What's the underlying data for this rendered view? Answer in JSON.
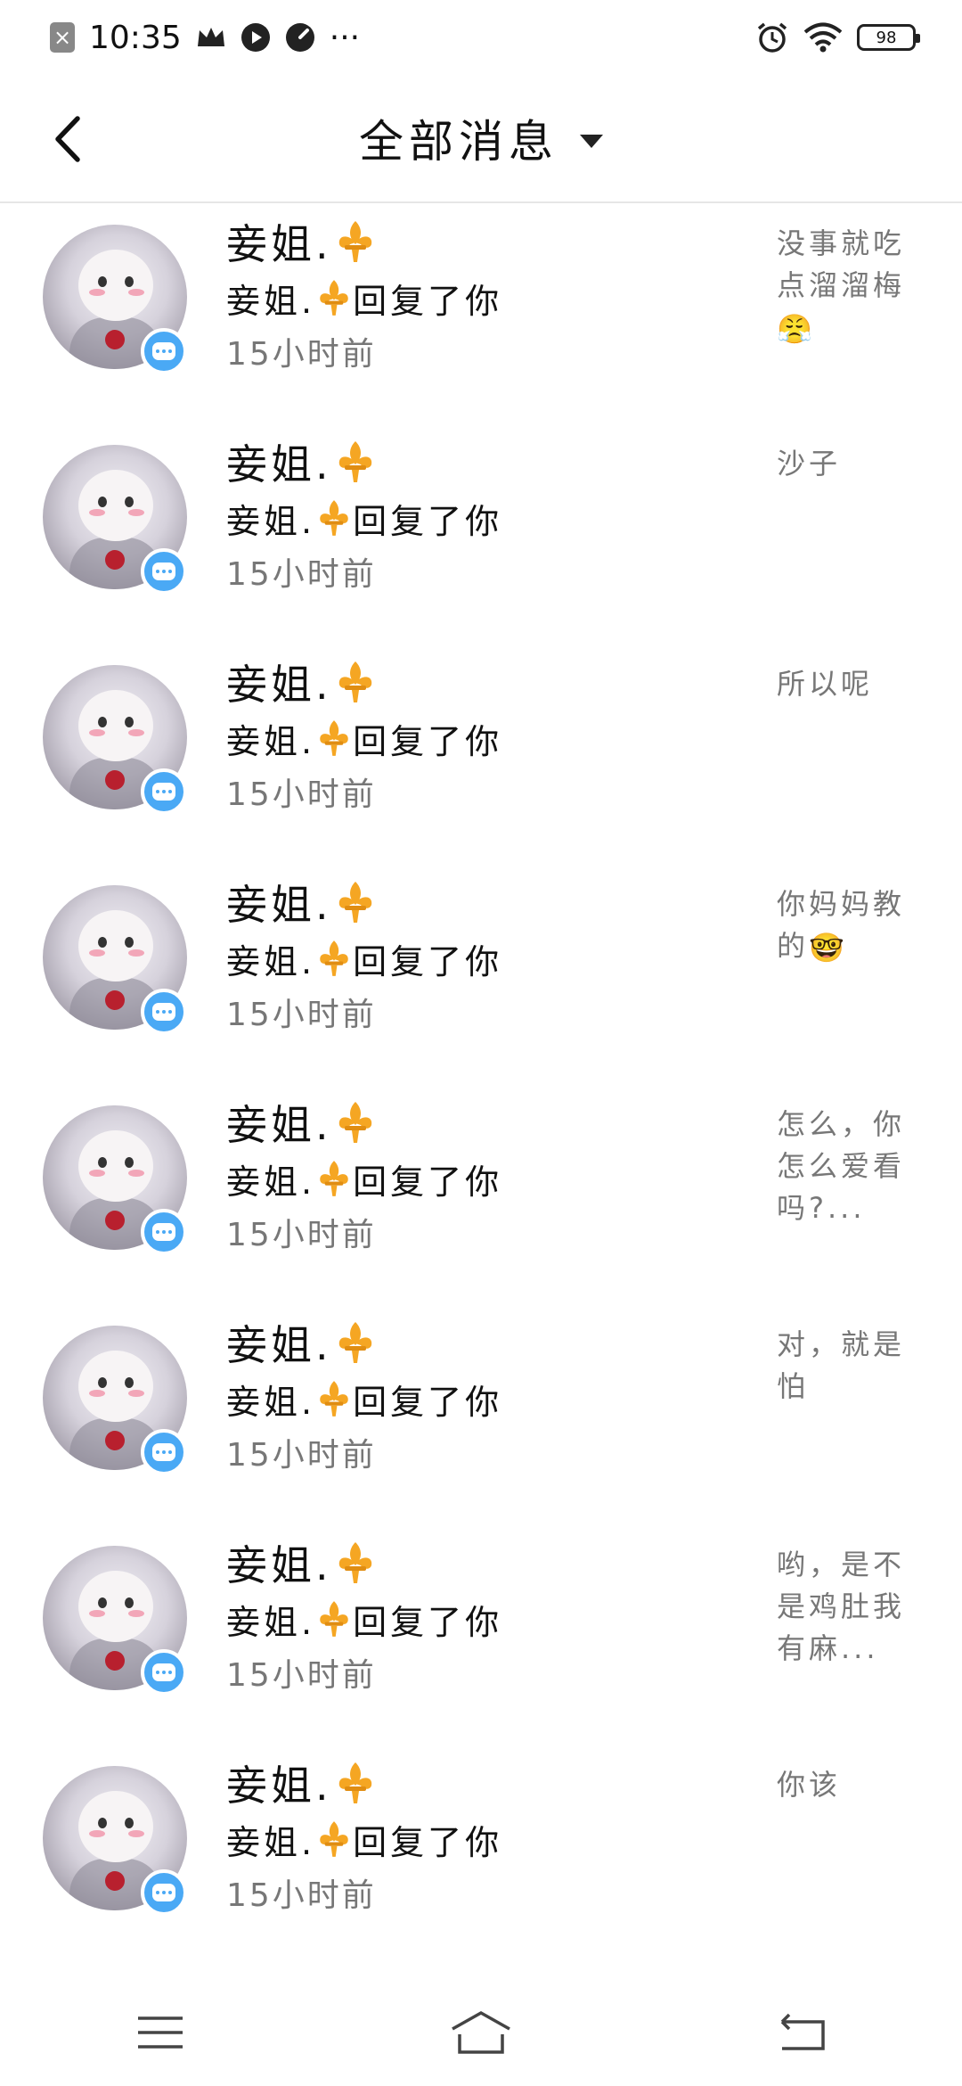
{
  "status_bar": {
    "time": "10:35",
    "more": "···",
    "battery": "98"
  },
  "header": {
    "title": "全部消息"
  },
  "messages": [
    {
      "name": "妾姐.",
      "reply_name": "妾姐.",
      "reply_text": "回复了你",
      "time": "15小时前",
      "preview": "没事就吃点溜溜梅",
      "preview_emoji": "😤"
    },
    {
      "name": "妾姐.",
      "reply_name": "妾姐.",
      "reply_text": "回复了你",
      "time": "15小时前",
      "preview": "沙子",
      "preview_emoji": ""
    },
    {
      "name": "妾姐.",
      "reply_name": "妾姐.",
      "reply_text": "回复了你",
      "time": "15小时前",
      "preview": "所以呢",
      "preview_emoji": ""
    },
    {
      "name": "妾姐.",
      "reply_name": "妾姐.",
      "reply_text": "回复了你",
      "time": "15小时前",
      "preview": "你妈妈教的",
      "preview_emoji": "🤓"
    },
    {
      "name": "妾姐.",
      "reply_name": "妾姐.",
      "reply_text": "回复了你",
      "time": "15小时前",
      "preview": "怎么，你怎么爱看吗?...",
      "preview_emoji": ""
    },
    {
      "name": "妾姐.",
      "reply_name": "妾姐.",
      "reply_text": "回复了你",
      "time": "15小时前",
      "preview": "对，就是怕",
      "preview_emoji": ""
    },
    {
      "name": "妾姐.",
      "reply_name": "妾姐.",
      "reply_text": "回复了你",
      "time": "15小时前",
      "preview": "哟，是不是鸡肚我有麻...",
      "preview_emoji": ""
    },
    {
      "name": "妾姐.",
      "reply_name": "妾姐.",
      "reply_text": "回复了你",
      "time": "15小时前",
      "preview": "你该",
      "preview_emoji": ""
    }
  ],
  "icons": {
    "back": "chevron-left-icon",
    "dropdown": "caret-down-icon",
    "badge": "chat-bubble-icon",
    "name_decoration": "fleur-de-lis-icon",
    "nav_menu": "menu-icon",
    "nav_home": "home-icon",
    "nav_back": "return-icon"
  },
  "colors": {
    "badge": "#4aa9f5",
    "fleur": "#f5a623",
    "secondary_text": "#777777"
  }
}
